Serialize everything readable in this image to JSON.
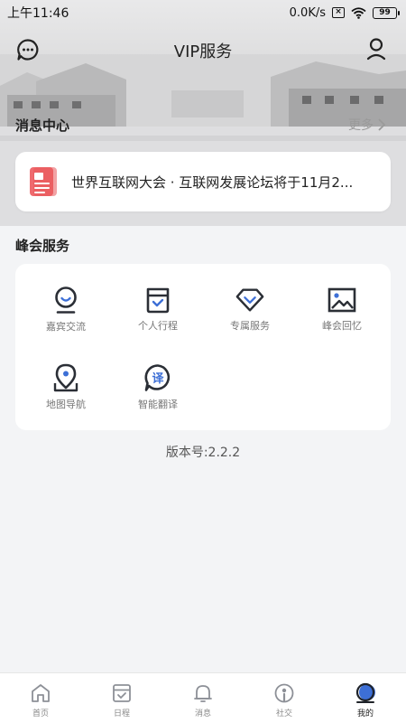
{
  "status": {
    "time": "上午11:46",
    "speed": "0.0K/s",
    "battery": "99"
  },
  "header": {
    "title": "VIP服务",
    "left_icon": "message-icon",
    "right_icon": "user-icon"
  },
  "news": {
    "section_title": "消息中心",
    "more_label": "更多",
    "items": [
      {
        "text": "世界互联网大会 · 互联网发展论坛将于11月2..."
      }
    ]
  },
  "services": {
    "section_title": "峰会服务",
    "items": [
      {
        "label": "嘉宾交流",
        "icon": "guest-icon"
      },
      {
        "label": "个人行程",
        "icon": "schedule-icon"
      },
      {
        "label": "专属服务",
        "icon": "diamond-icon"
      },
      {
        "label": "峰会回忆",
        "icon": "image-icon"
      },
      {
        "label": "地图导航",
        "icon": "map-pin-icon"
      },
      {
        "label": "智能翻译",
        "icon": "translate-icon"
      }
    ]
  },
  "version": "版本号:2.2.2",
  "tabbar": {
    "tabs": [
      {
        "label": "首页",
        "icon": "home-icon"
      },
      {
        "label": "日程",
        "icon": "calendar-icon"
      },
      {
        "label": "消息",
        "icon": "bell-icon"
      },
      {
        "label": "社交",
        "icon": "social-icon"
      },
      {
        "label": "我的",
        "icon": "profile-icon"
      }
    ],
    "active_index": 4
  },
  "colors": {
    "accent": "#3d6fd6",
    "icon_dark": "#2b2f36",
    "news_icon": "#e8555a"
  }
}
